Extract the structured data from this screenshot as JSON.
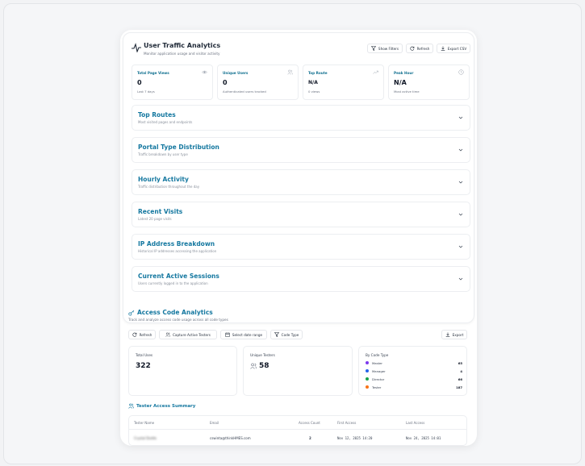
{
  "traffic": {
    "title": "User Traffic Analytics",
    "subtitle": "Monitor application usage and visitor activity",
    "buttons": {
      "filters": "Show Filters",
      "refresh": "Refresh",
      "export": "Export CSV"
    },
    "stats": [
      {
        "label": "Total Page Views",
        "value": "0",
        "sub": "Last 7 days",
        "icon": "eye-icon"
      },
      {
        "label": "Unique Users",
        "value": "0",
        "sub": "Authenticated users tracked",
        "icon": "users-icon"
      },
      {
        "label": "Top Route",
        "value": "N/A",
        "sub": "0 views",
        "icon": "trending-icon"
      },
      {
        "label": "Peak Hour",
        "value": "N/A",
        "sub": "Most active time",
        "icon": "clock-icon"
      }
    ],
    "sections": [
      {
        "title": "Top Routes",
        "sub": "Most visited pages and endpoints"
      },
      {
        "title": "Portal Type Distribution",
        "sub": "Traffic breakdown by user type"
      },
      {
        "title": "Hourly Activity",
        "sub": "Traffic distribution throughout the day"
      },
      {
        "title": "Recent Visits",
        "sub": "Latest 20 page visits"
      },
      {
        "title": "IP Address Breakdown",
        "sub": "Historical IP addresses accessing the application"
      },
      {
        "title": "Current Active Sessions",
        "sub": "Users currently logged in to the application"
      }
    ]
  },
  "access": {
    "title": "Access Code Analytics",
    "subtitle": "Track and analyze access code usage across all code types",
    "buttons": {
      "refresh": "Refresh",
      "capture": "Capture Active Testers",
      "date": "Select date range",
      "code_type": "Code Type",
      "export": "Export"
    },
    "total_uses_label": "Total Uses",
    "total_uses": "322",
    "unique_testers_label": "Unique Testers",
    "unique_testers": "58",
    "by_code_type_label": "By Code Type",
    "code_types": [
      {
        "name": "Master",
        "count": "65",
        "color": "#7c3aed"
      },
      {
        "name": "Manager",
        "count": "4",
        "color": "#2563eb"
      },
      {
        "name": "Director",
        "count": "66",
        "color": "#16a34a"
      },
      {
        "name": "Tester",
        "count": "187",
        "color": "#f97316"
      }
    ]
  },
  "tester_summary": {
    "title": "Tester Access Summary",
    "columns": [
      "Tester Name",
      "Email",
      "Access Count",
      "First Access",
      "Last Access"
    ],
    "rows": [
      {
        "name": "Crystal Dodds",
        "email": "cswinta@thinkHMES.com",
        "count": "2",
        "first": "Nov 12, 2025 14:20",
        "last": "Nov 24, 2025 14:01"
      }
    ]
  }
}
